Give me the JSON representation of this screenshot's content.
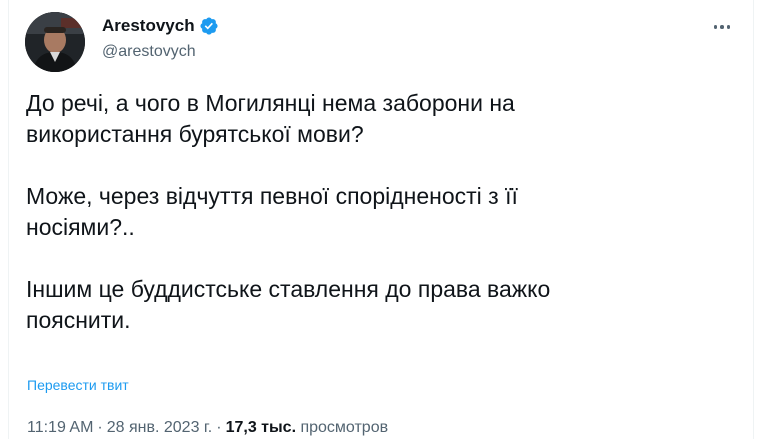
{
  "author": {
    "display_name": "Arestovych",
    "handle": "@arestovych",
    "verified": true,
    "verified_color": "#1d9bf0"
  },
  "tweet": {
    "paragraphs": [
      [
        "До речі, а чого в Могилянці нема заборони на",
        "використання бурятської мови?"
      ],
      [
        "Може, через відчуття певної спорідненості з її",
        "носіями?.."
      ],
      [
        "Іншим це буддистське ставлення до права важко",
        "пояснити."
      ]
    ],
    "translate_label": "Перевести твит"
  },
  "meta": {
    "time": "11:19 AM",
    "date": "28 янв. 2023 г.",
    "separator": "·",
    "views_count": "17,3 тыс.",
    "views_label": "просмотров"
  },
  "colors": {
    "text": "#0f1419",
    "secondary": "#536471",
    "link": "#1d9bf0"
  },
  "icons": {
    "more": "more-horizontal-icon",
    "verified": "verified-badge-icon"
  }
}
